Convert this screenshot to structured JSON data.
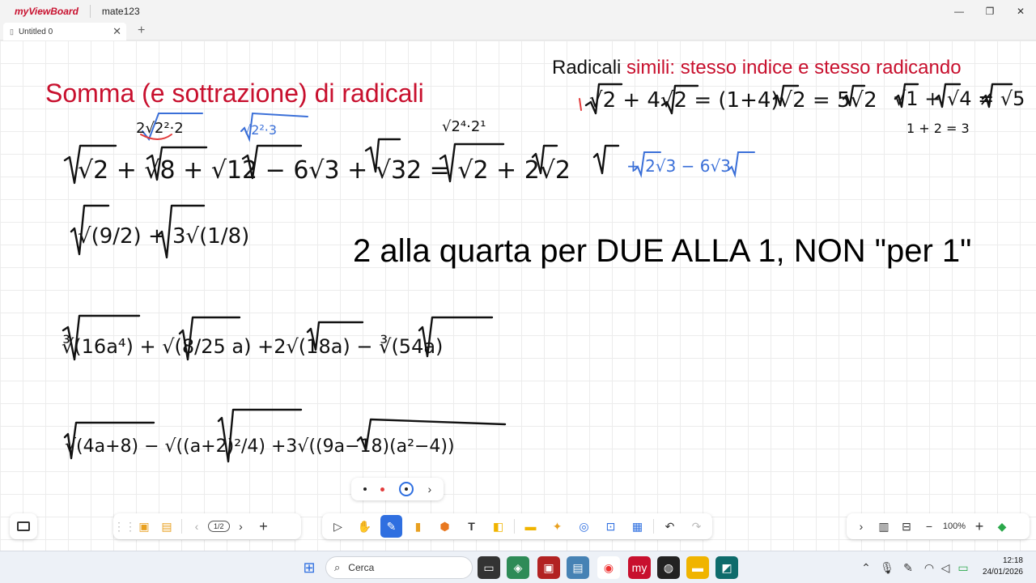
{
  "app": {
    "logo": "myViewBoard",
    "window_title": "mate123",
    "minimize": "—",
    "maximize": "❐",
    "close": "✕"
  },
  "tabs": [
    {
      "label": "Untitled 0",
      "close": "✕"
    }
  ],
  "new_tab": "+",
  "board": {
    "heading": "Somma (e sottrazione)  di radicali",
    "rule_prefix": "Radicali ",
    "rule_highlight": "simili: stesso indice e stesso radicando",
    "note": "2 alla quarta per DUE ALLA 1, NON \"per 1\""
  },
  "handwriting": {
    "example_sum": "√2 + 4√2 = (1+4)√2 = 5√2",
    "counter_example": "√1 + √4 ≠ √5",
    "counter_values": "1  +  2  =  3",
    "line1": "√2  +  √8  +  √12  − 6√3  +  √32  =  √2  + 2√2",
    "line1_blue": "+ 2√3  − 6√3",
    "ann1": "2√2²·2",
    "ann2": "√2²·3",
    "ann3": "√2⁴·2¹",
    "line2": "√(9/2)  + 3√(1/8)",
    "line3": "∛(16a⁴)  +  √(8/25 a)     +2√(18a)  −  ∛(54a)",
    "line4": "√(4a+8)   −   √((a+2)²/4)     +3√((9a−18)(a²−4))"
  },
  "mini_palette": {
    "more": "›"
  },
  "left_toolbar": {
    "page": "1/2",
    "prev": "‹",
    "next": "›",
    "add": "+"
  },
  "center_toolbar": {
    "text_tool": "T",
    "undo": "↶",
    "redo": "↷"
  },
  "right_toolbar": {
    "collapse": "›",
    "zoom_out": "−",
    "zoom": "100%",
    "zoom_in": "+"
  },
  "taskbar": {
    "search_placeholder": "Cerca",
    "time": "12:18",
    "date": "24/01/2026",
    "chevron": "⌃"
  },
  "colors": {
    "accent": "#2f6fe0",
    "brand_red": "#c8102e",
    "ink_blue": "#3a6fd8"
  }
}
